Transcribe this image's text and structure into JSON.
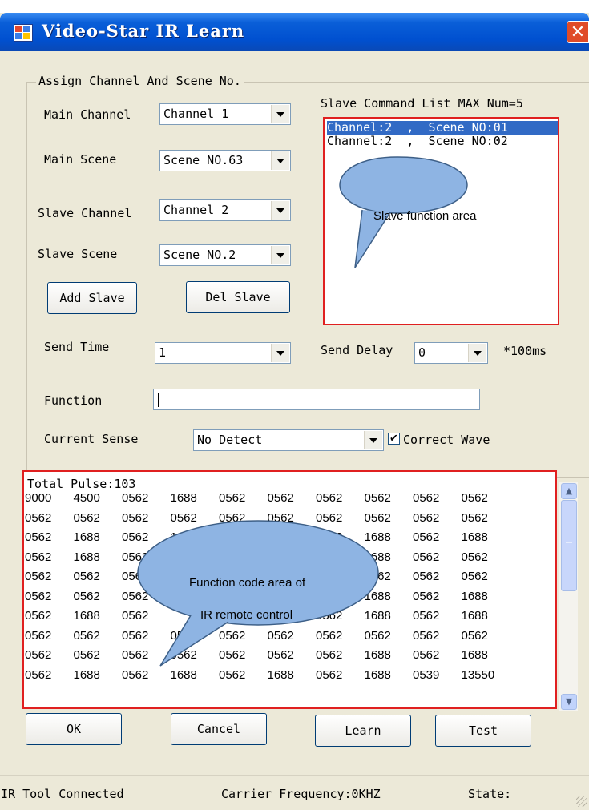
{
  "window": {
    "title": "Video-Star IR Learn",
    "close_glyph": "✕"
  },
  "assign_group": {
    "label": "Assign Channel And Scene No.",
    "main_channel": {
      "label": "Main Channel",
      "value": "Channel 1"
    },
    "main_scene": {
      "label": "Main Scene",
      "value": "Scene NO.63"
    },
    "slave_channel": {
      "label": "Slave Channel",
      "value": "Channel 2"
    },
    "slave_scene": {
      "label": "Slave Scene",
      "value": "Scene NO.2"
    },
    "add_slave": "Add Slave",
    "del_slave": "Del Slave",
    "slave_list_title": "Slave Command List MAX Num=5",
    "slave_list": [
      {
        "channel": "Channel:2",
        "sep": ",",
        "scene": "Scene NO:01"
      },
      {
        "channel": "Channel:2",
        "sep": ",",
        "scene": "Scene NO:02"
      }
    ],
    "send_time": {
      "label": "Send Time",
      "value": "1"
    },
    "send_delay": {
      "label": "Send Delay",
      "value": "0",
      "unit": "*100ms"
    },
    "function": {
      "label": "Function",
      "value": ""
    },
    "current_sense": {
      "label": "Current Sense",
      "value": "No Detect"
    },
    "correct_wave": {
      "label": "Correct Wave",
      "checked": true,
      "check_glyph": "✔"
    }
  },
  "annotations": {
    "slave_area": "Slave function area",
    "code_area_line1": "Function code area of",
    "code_area_line2": "IR remote control"
  },
  "pulse": {
    "header": "Total Pulse:103",
    "rows": [
      [
        "9000",
        "4500",
        "0562",
        "1688",
        "0562",
        "0562",
        "0562",
        "0562",
        "0562",
        "0562"
      ],
      [
        "0562",
        "0562",
        "0562",
        "0562",
        "0562",
        "0562",
        "0562",
        "0562",
        "0562",
        "0562"
      ],
      [
        "0562",
        "1688",
        "0562",
        "1688",
        "",
        "",
        "0562",
        "1688",
        "0562",
        "1688"
      ],
      [
        "0562",
        "1688",
        "0562",
        "",
        "",
        "",
        "",
        "1688",
        "0562",
        "0562"
      ],
      [
        "0562",
        "0562",
        "0562",
        "",
        "",
        "",
        "",
        "0562",
        "0562",
        "0562"
      ],
      [
        "0562",
        "0562",
        "0562",
        "",
        "",
        "",
        "",
        "1688",
        "0562",
        "1688"
      ],
      [
        "0562",
        "1688",
        "0562",
        "",
        "",
        "",
        "0562",
        "1688",
        "0562",
        "1688"
      ],
      [
        "0562",
        "0562",
        "0562",
        "0562",
        "0562",
        "0562",
        "0562",
        "0562",
        "0562",
        "0562"
      ],
      [
        "0562",
        "0562",
        "0562",
        "0562",
        "0562",
        "0562",
        "0562",
        "1688",
        "0562",
        "1688"
      ],
      [
        "0562",
        "1688",
        "0562",
        "1688",
        "0562",
        "1688",
        "0562",
        "1688",
        "0539",
        "13550"
      ]
    ],
    "scroll_up_glyph": "▲",
    "scroll_down_glyph": "▼",
    "scroll_thumb_position": 0.0
  },
  "buttons": {
    "ok": "OK",
    "cancel": "Cancel",
    "learn": "Learn",
    "test": "Test"
  },
  "status": {
    "connection": "IR Tool Connected",
    "carrier": "Carrier Frequency:0KHZ",
    "state": "State:"
  },
  "colors": {
    "title_bar": "#0050d0",
    "selection": "#316ac5",
    "highlight_border": "#e02020",
    "callout_fill": "#8eb4e3"
  }
}
